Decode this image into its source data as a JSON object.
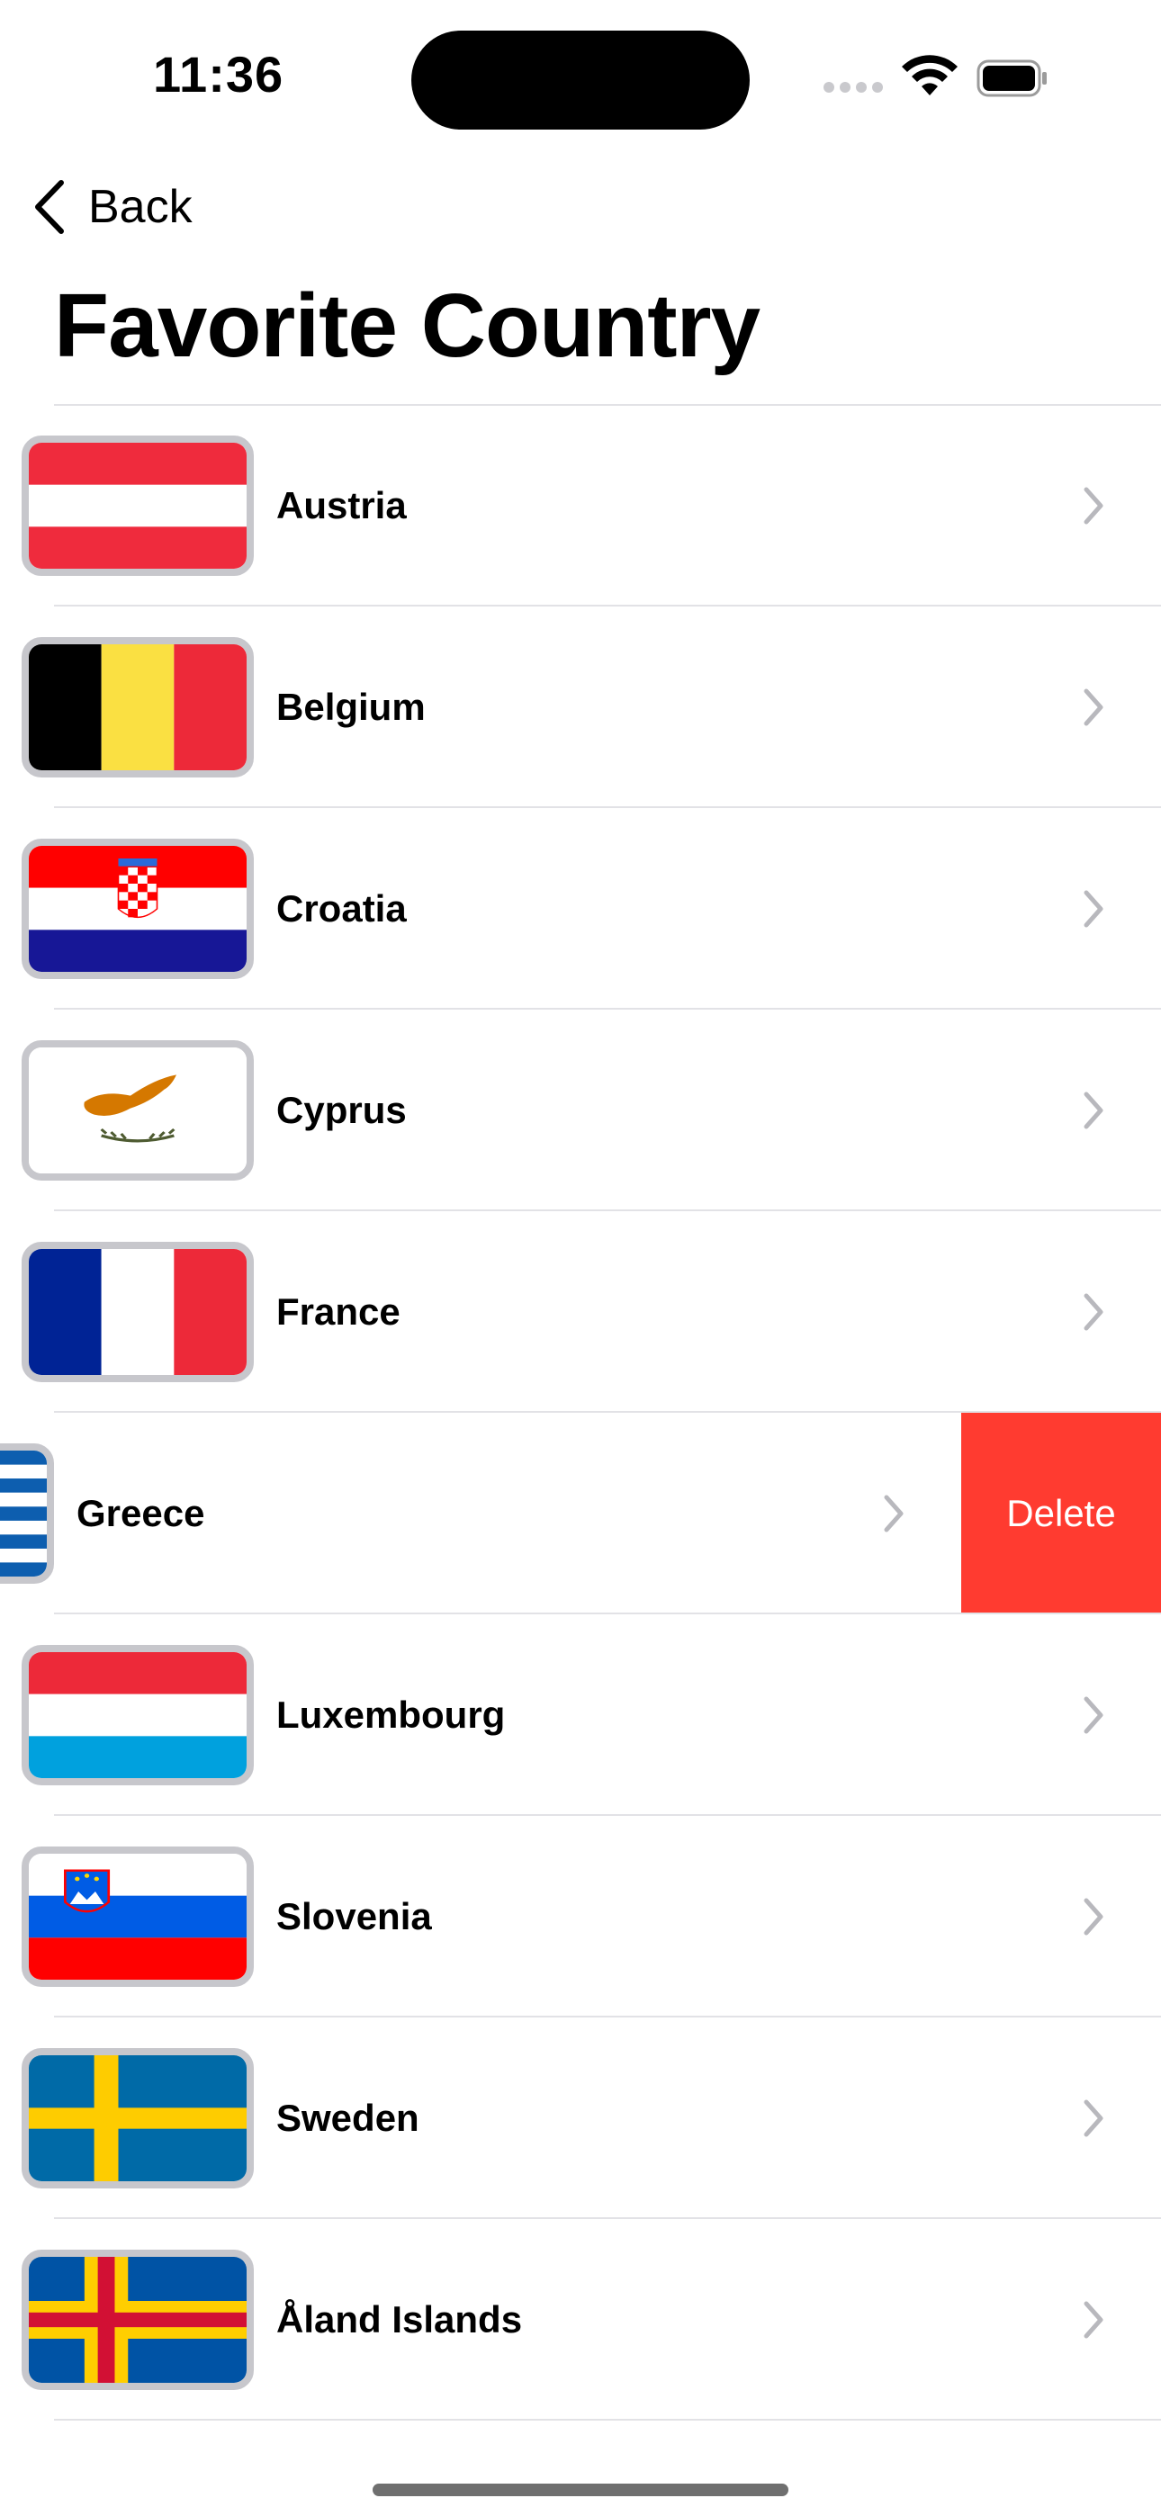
{
  "status_bar": {
    "time": "11:36"
  },
  "nav": {
    "back_label": "Back"
  },
  "page": {
    "title": "Favorite Country"
  },
  "countries": [
    {
      "name": "Austria"
    },
    {
      "name": "Belgium"
    },
    {
      "name": "Croatia"
    },
    {
      "name": "Cyprus"
    },
    {
      "name": "France"
    },
    {
      "name": "Greece",
      "swiped": true
    },
    {
      "name": "Luxembourg"
    },
    {
      "name": "Slovenia"
    },
    {
      "name": "Sweden"
    },
    {
      "name": "Åland Islands"
    }
  ],
  "swipe_action": {
    "label": "Delete",
    "color": "#ff3b30"
  }
}
